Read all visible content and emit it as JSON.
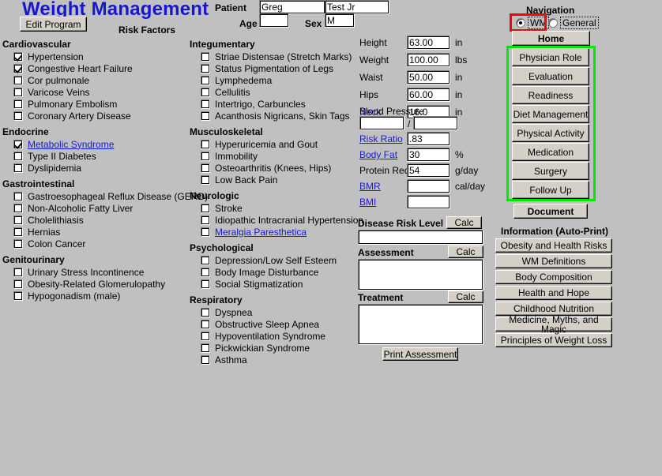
{
  "app": {
    "title": "Weight Management",
    "edit_program_label": "Edit Program",
    "risk_factors_label": "Risk Factors"
  },
  "patient": {
    "patient_label": "Patient",
    "first_name": "Greg",
    "last_name": "Test Jr",
    "age_label": "Age",
    "age": "",
    "sex_label": "Sex",
    "sex": "M"
  },
  "risk_factor_columns": [
    {
      "groups": [
        {
          "name": "Cardiovascular",
          "items": [
            {
              "label": "Hypertension",
              "checked": true,
              "link": false
            },
            {
              "label": "Congestive Heart Failure",
              "checked": true,
              "link": false
            },
            {
              "label": "Cor pulmonale",
              "checked": false,
              "link": false
            },
            {
              "label": "Varicose Veins",
              "checked": false,
              "link": false
            },
            {
              "label": "Pulmonary Embolism",
              "checked": false,
              "link": false
            },
            {
              "label": "Coronary Artery Disease",
              "checked": false,
              "link": false
            }
          ]
        },
        {
          "name": "Endocrine",
          "items": [
            {
              "label": "Metabolic Syndrome",
              "checked": true,
              "link": true
            },
            {
              "label": "Type II Diabetes",
              "checked": false,
              "link": false
            },
            {
              "label": "Dyslipidemia",
              "checked": false,
              "link": false
            }
          ]
        },
        {
          "name": "Gastrointestinal",
          "items": [
            {
              "label": "Gastroesophageal Reflux Disease (GERD)",
              "checked": false,
              "link": false
            },
            {
              "label": "Non-Alcoholic Fatty Liver",
              "checked": false,
              "link": false
            },
            {
              "label": "Cholelithiasis",
              "checked": false,
              "link": false
            },
            {
              "label": "Hernias",
              "checked": false,
              "link": false
            },
            {
              "label": "Colon Cancer",
              "checked": false,
              "link": false
            }
          ]
        },
        {
          "name": "Genitourinary",
          "items": [
            {
              "label": "Urinary Stress Incontinence",
              "checked": false,
              "link": false
            },
            {
              "label": "Obesity-Related Glomerulopathy",
              "checked": false,
              "link": false
            },
            {
              "label": "Hypogonadism (male)",
              "checked": false,
              "link": false
            }
          ]
        }
      ]
    },
    {
      "groups": [
        {
          "name": "Integumentary",
          "items": [
            {
              "label": "Striae Distensae (Stretch Marks)",
              "checked": false,
              "link": false
            },
            {
              "label": "Status Pigmentation of Legs",
              "checked": false,
              "link": false
            },
            {
              "label": "Lymphedema",
              "checked": false,
              "link": false
            },
            {
              "label": "Cellulitis",
              "checked": false,
              "link": false
            },
            {
              "label": "Intertrigo, Carbuncles",
              "checked": false,
              "link": false
            },
            {
              "label": "Acanthosis Nigricans, Skin Tags",
              "checked": false,
              "link": false
            }
          ]
        },
        {
          "name": "Musculoskeletal",
          "items": [
            {
              "label": "Hyperuricemia and Gout",
              "checked": false,
              "link": false
            },
            {
              "label": "Immobility",
              "checked": false,
              "link": false
            },
            {
              "label": "Osteoarthritis (Knees, Hips)",
              "checked": false,
              "link": false
            },
            {
              "label": "Low Back Pain",
              "checked": false,
              "link": false
            }
          ]
        },
        {
          "name": "Neurologic",
          "items": [
            {
              "label": "Stroke",
              "checked": false,
              "link": false
            },
            {
              "label": "Idiopathic Intracranial Hypertension",
              "checked": false,
              "link": false
            },
            {
              "label": "Meralgia Paresthetica",
              "checked": false,
              "link": true
            }
          ]
        },
        {
          "name": "Psychological",
          "items": [
            {
              "label": "Depression/Low Self Esteem",
              "checked": false,
              "link": false
            },
            {
              "label": "Body Image Disturbance",
              "checked": false,
              "link": false
            },
            {
              "label": "Social Stigmatization",
              "checked": false,
              "link": false
            }
          ]
        },
        {
          "name": "Respiratory",
          "items": [
            {
              "label": "Dyspnea",
              "checked": false,
              "link": false
            },
            {
              "label": "Obstructive Sleep Apnea",
              "checked": false,
              "link": false
            },
            {
              "label": "Hypoventilation Syndrome",
              "checked": false,
              "link": false
            },
            {
              "label": "Pickwickian Syndrome",
              "checked": false,
              "link": false
            },
            {
              "label": "Asthma",
              "checked": false,
              "link": false
            }
          ]
        }
      ]
    }
  ],
  "measurements": [
    {
      "label": "Height",
      "value": "63.00",
      "unit": "in",
      "link": false
    },
    {
      "label": "Weight",
      "value": "100.00",
      "unit": "lbs",
      "link": false
    },
    {
      "label": "Waist",
      "value": "50.00",
      "unit": "in",
      "link": false
    },
    {
      "label": "Hips",
      "value": "60.00",
      "unit": "in",
      "link": false
    },
    {
      "label": "Neck",
      "value": "16.0",
      "unit": "in",
      "link": true
    }
  ],
  "blood_pressure": {
    "label": "Blood Pressure",
    "systolic": "",
    "separator": "/",
    "diastolic": ""
  },
  "derived": [
    {
      "label": "Risk Ratio",
      "value": ".83",
      "unit": "",
      "link": true
    },
    {
      "label": "Body Fat",
      "value": "30",
      "unit": "%",
      "link": true
    },
    {
      "label": "Protein Req",
      "value": "54",
      "unit": "g/day",
      "link": false
    },
    {
      "label": "BMR",
      "value": "",
      "unit": "cal/day",
      "link": true
    },
    {
      "label": "BMI",
      "value": "",
      "unit": "",
      "link": true
    }
  ],
  "assessment_panel": {
    "calc_label": "Calc",
    "disease_risk_level_label": "Disease Risk Level",
    "disease_risk_level_value": "",
    "assessment_label": "Assessment",
    "assessment_value": "",
    "treatment_label": "Treatment",
    "treatment_value": "",
    "print_assessment_label": "Print Assessment"
  },
  "navigation": {
    "title": "Navigation",
    "mode_wm_label": "WM",
    "mode_general_label": "General",
    "selected_mode": "WM",
    "home_label": "Home",
    "buttons": [
      "Physician Role",
      "Evaluation",
      "Readiness",
      "Diet Management",
      "Physical Activity",
      "Medication",
      "Surgery",
      "Follow Up"
    ],
    "document_label": "Document",
    "highlight_red": "#ff0000",
    "highlight_green": "#00e800"
  },
  "information": {
    "title": "Information (Auto-Print)",
    "buttons": [
      "Obesity and Health Risks",
      "WM Definitions",
      "Body Composition",
      "Health and Hope",
      "Childhood Nutrition",
      "Medicine, Myths, and Magic",
      "Principles of Weight Loss"
    ]
  }
}
